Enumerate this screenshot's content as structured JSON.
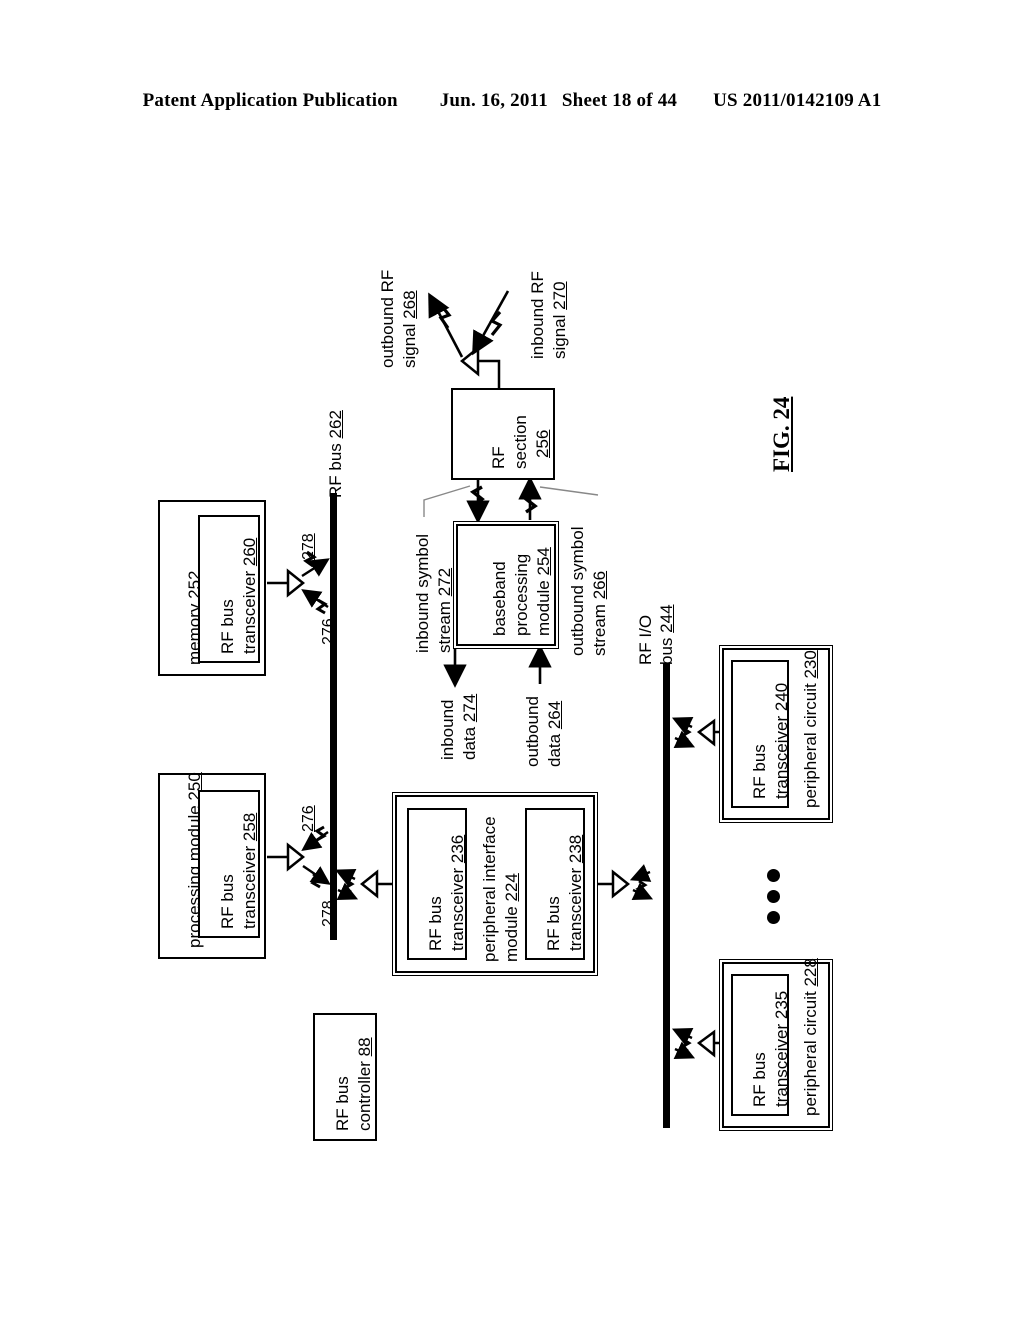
{
  "header": {
    "publication": "Patent Application Publication",
    "date": "Jun. 16, 2011",
    "sheet": "Sheet 18 of 44",
    "patent_number": "US 2011/0142109 A1"
  },
  "figure": {
    "label": "FIG. 24"
  },
  "blocks": {
    "memory": {
      "title": "memory",
      "ref": "252"
    },
    "memory_transceiver": {
      "line1": "RF bus",
      "line2": "transceiver",
      "ref": "260"
    },
    "processing_module": {
      "title": "processing module",
      "ref": "250"
    },
    "processing_transceiver": {
      "line1": "RF bus",
      "line2": "transceiver",
      "ref": "258"
    },
    "rf_section": {
      "line1": "RF",
      "line2": "section",
      "ref": "256"
    },
    "baseband": {
      "line1": "baseband",
      "line2": "processing",
      "line3": "module",
      "ref": "254"
    },
    "peripheral_interface": {
      "line1": "peripheral interface",
      "line2": "module",
      "ref": "224"
    },
    "pim_transceiver_left": {
      "line1": "RF bus",
      "line2": "transceiver",
      "ref": "236"
    },
    "pim_transceiver_right": {
      "line1": "RF bus",
      "line2": "transceiver",
      "ref": "238"
    },
    "rf_bus_controller": {
      "line1": "RF bus",
      "line2": "controller",
      "ref": "88"
    },
    "peripheral_circuit_230": {
      "title": "peripheral circuit",
      "ref": "230"
    },
    "pc230_transceiver": {
      "line1": "RF bus",
      "line2": "transceiver",
      "ref": "240"
    },
    "peripheral_circuit_228": {
      "title": "peripheral circuit",
      "ref": "228"
    },
    "pc228_transceiver": {
      "line1": "RF bus",
      "line2": "transceiver",
      "ref": "235"
    }
  },
  "buses": {
    "rf_bus": {
      "label": "RF bus",
      "ref": "262"
    },
    "rf_io_bus": {
      "line1": "RF I/O",
      "line2": "bus",
      "ref": "244"
    }
  },
  "signals": {
    "outbound_rf": {
      "line1": "outbound RF",
      "line2": "signal",
      "ref": "268"
    },
    "inbound_rf": {
      "line1": "inbound RF",
      "line2": "signal",
      "ref": "270"
    },
    "inbound_symbol_stream": {
      "line1": "inbound symbol",
      "line2": "stream",
      "ref": "272"
    },
    "outbound_symbol_stream": {
      "line1": "outbound symbol",
      "line2": "stream",
      "ref": "266"
    },
    "inbound_data": {
      "line1": "inbound",
      "line2": "data",
      "ref": "274"
    },
    "outbound_data": {
      "line1": "outbound",
      "line2": "data",
      "ref": "264"
    }
  },
  "arrow_refs": {
    "mem_278": "278",
    "mem_276": "276",
    "proc_276": "276",
    "proc_278": "278"
  },
  "colors": {
    "ink": "#000000",
    "paper": "#ffffff"
  }
}
